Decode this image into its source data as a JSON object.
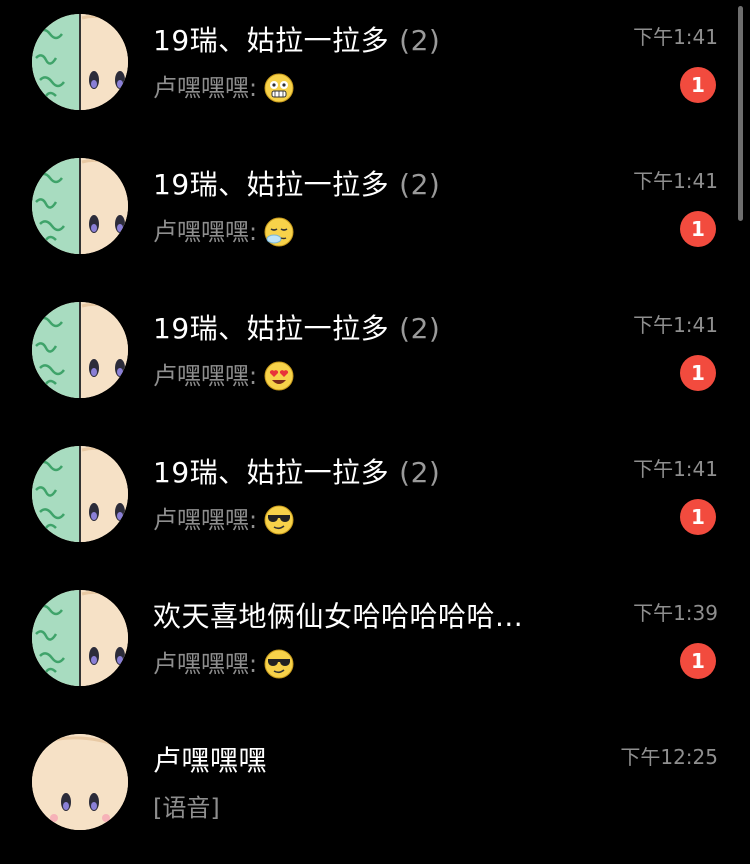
{
  "conversations": [
    {
      "avatar": "half-doll-avatar",
      "title": "19瑞、姑拉一拉多",
      "count": "(2)",
      "preview": "卢嘿嘿嘿:",
      "emoji": "shocked-face-emoji",
      "time": "下午1:41",
      "unread": "1"
    },
    {
      "avatar": "half-doll-avatar",
      "title": "19瑞、姑拉一拉多",
      "count": "(2)",
      "preview": "卢嘿嘿嘿:",
      "emoji": "sleepy-face-emoji",
      "time": "下午1:41",
      "unread": "1"
    },
    {
      "avatar": "half-doll-avatar",
      "title": "19瑞、姑拉一拉多",
      "count": "(2)",
      "preview": "卢嘿嘿嘿:",
      "emoji": "heart-eyes-emoji",
      "time": "下午1:41",
      "unread": "1"
    },
    {
      "avatar": "half-doll-avatar",
      "title": "19瑞、姑拉一拉多",
      "count": "(2)",
      "preview": "卢嘿嘿嘿:",
      "emoji": "sunglasses-face-emoji",
      "time": "下午1:41",
      "unread": "1"
    },
    {
      "avatar": "half-doll-avatar",
      "title": "欢天喜地俩仙女哈哈哈哈哈...",
      "count": "",
      "preview": "卢嘿嘿嘿:",
      "emoji": "sunglasses-face-emoji",
      "time": "下午1:39",
      "unread": "1"
    },
    {
      "avatar": "doll-avatar",
      "title": "卢嘿嘿嘿",
      "count": "",
      "preview": "[语音]",
      "emoji": "",
      "time": "下午12:25",
      "unread": ""
    }
  ],
  "colors": {
    "background": "#000000",
    "title": "#ffffff",
    "secondary": "#8e8e8e",
    "badge": "#f24b3e"
  }
}
